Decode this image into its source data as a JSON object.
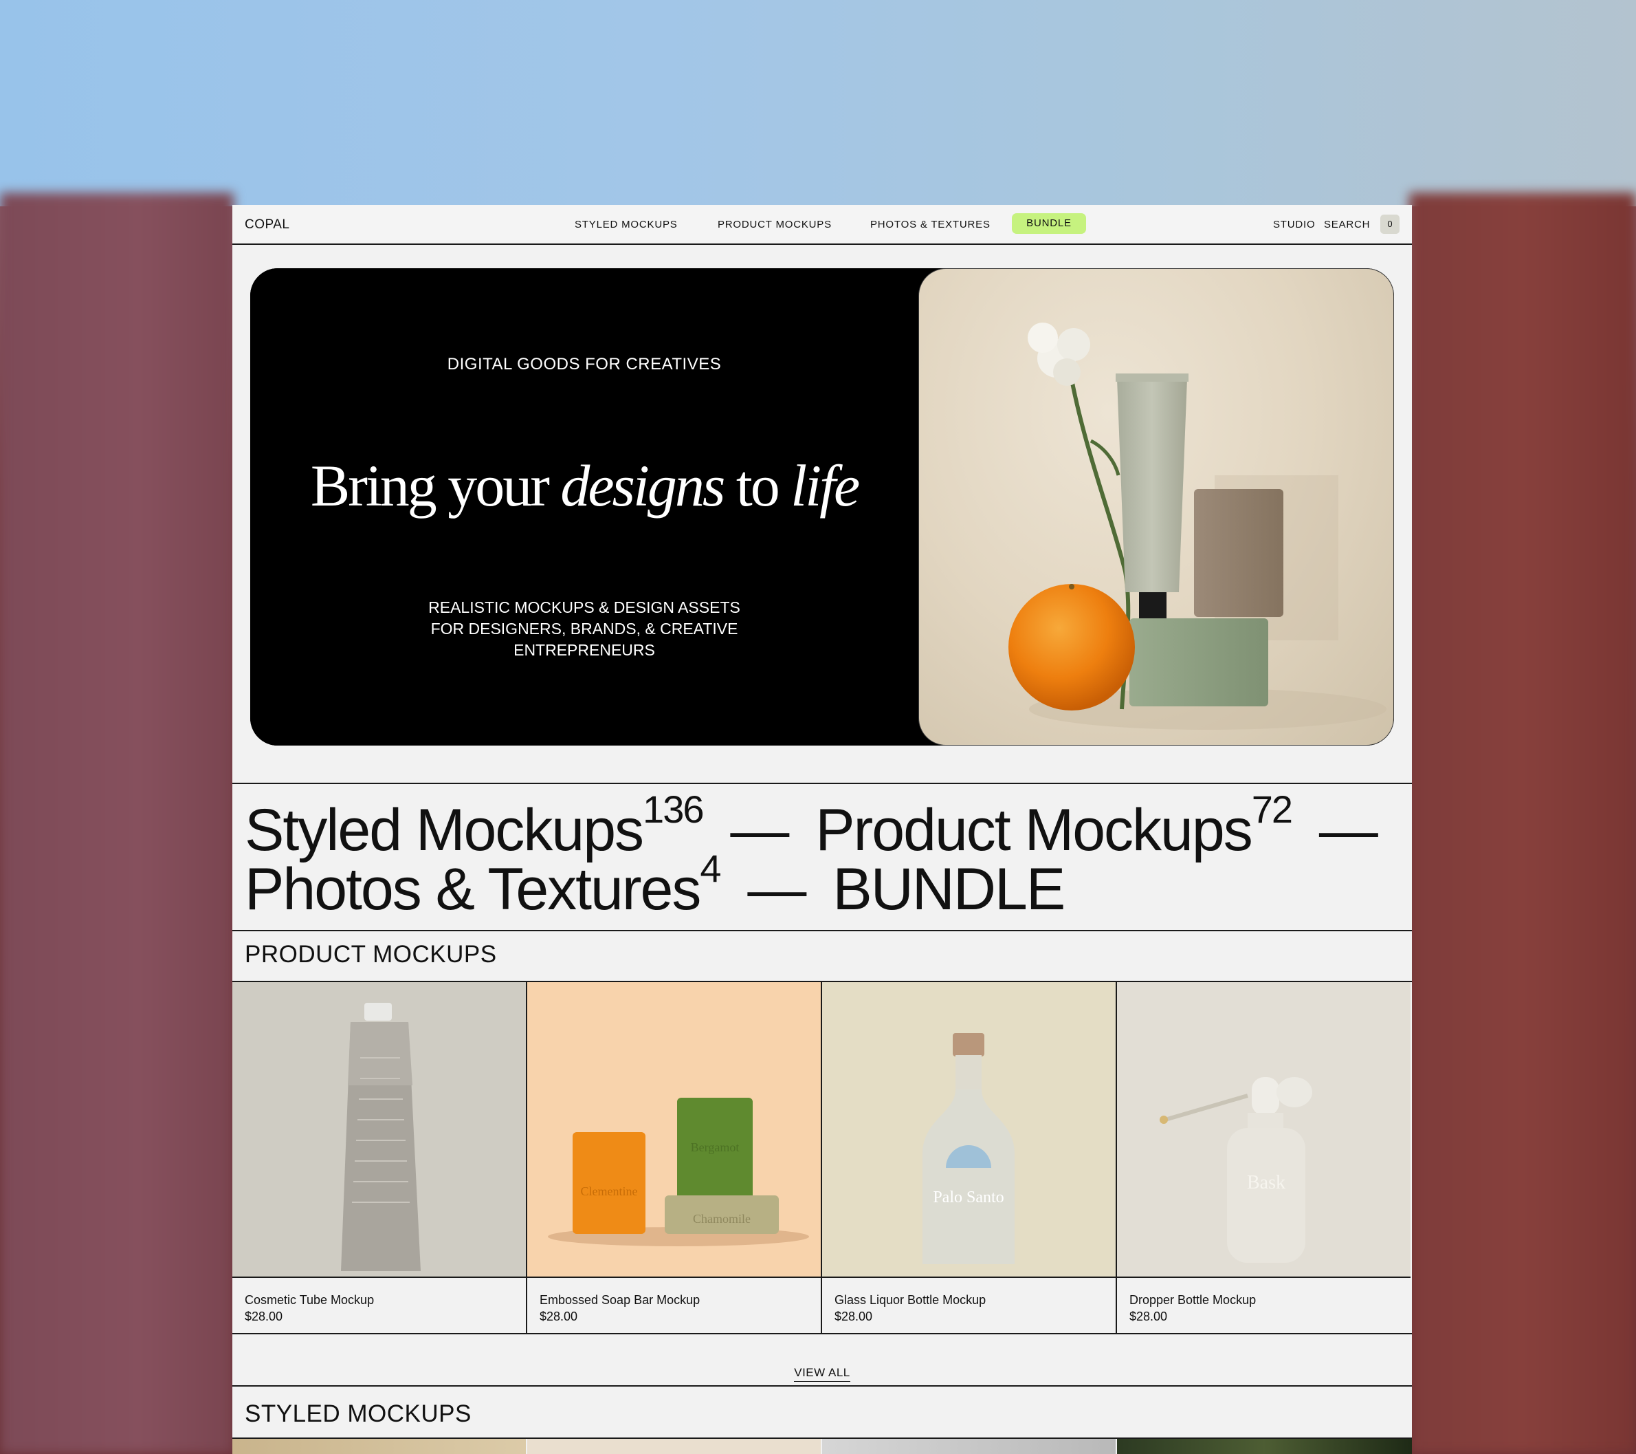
{
  "nav": {
    "logo": "COPAL",
    "items": [
      "STYLED MOCKUPS",
      "PRODUCT MOCKUPS",
      "PHOTOS & TEXTURES"
    ],
    "bundle": "BUNDLE",
    "studio": "STUDIO",
    "search": "SEARCH",
    "cart_count": "0"
  },
  "hero": {
    "eyebrow": "DIGITAL GOODS FOR CREATIVES",
    "headline_1": "Bring your ",
    "headline_2": "designs",
    "headline_3": " to ",
    "headline_4": "life",
    "sub": "REALISTIC MOCKUPS & DESIGN ASSETS FOR DESIGNERS, BRANDS, & CREATIVE ENTREPRENEURS"
  },
  "categories": {
    "styled": "Styled Mockups",
    "styled_count": "136",
    "product": "Product Mockups",
    "product_count": "72",
    "photos": "Photos & Textures",
    "photos_count": "4",
    "bundle": "BUNDLE",
    "dash": "—"
  },
  "product_section": {
    "title": "PRODUCT MOCKUPS",
    "items": [
      {
        "name": "Cosmetic Tube Mockup",
        "price": "$28.00",
        "bg": "#cfccc3"
      },
      {
        "name": "Embossed Soap Bar Mockup",
        "price": "$28.00",
        "bg": "#f8d3ac",
        "labels": [
          "Clementine",
          "Bergamot",
          "Chamomile"
        ]
      },
      {
        "name": "Glass Liquor Bottle Mockup",
        "price": "$28.00",
        "bg": "#e4ddc5",
        "label": "Palo Santo"
      },
      {
        "name": "Dropper Bottle Mockup",
        "price": "$28.00",
        "bg": "#e2ded5",
        "label": "Bask"
      }
    ],
    "view_all": "VIEW ALL"
  },
  "styled_section": {
    "title": "STYLED MOCKUPS"
  }
}
